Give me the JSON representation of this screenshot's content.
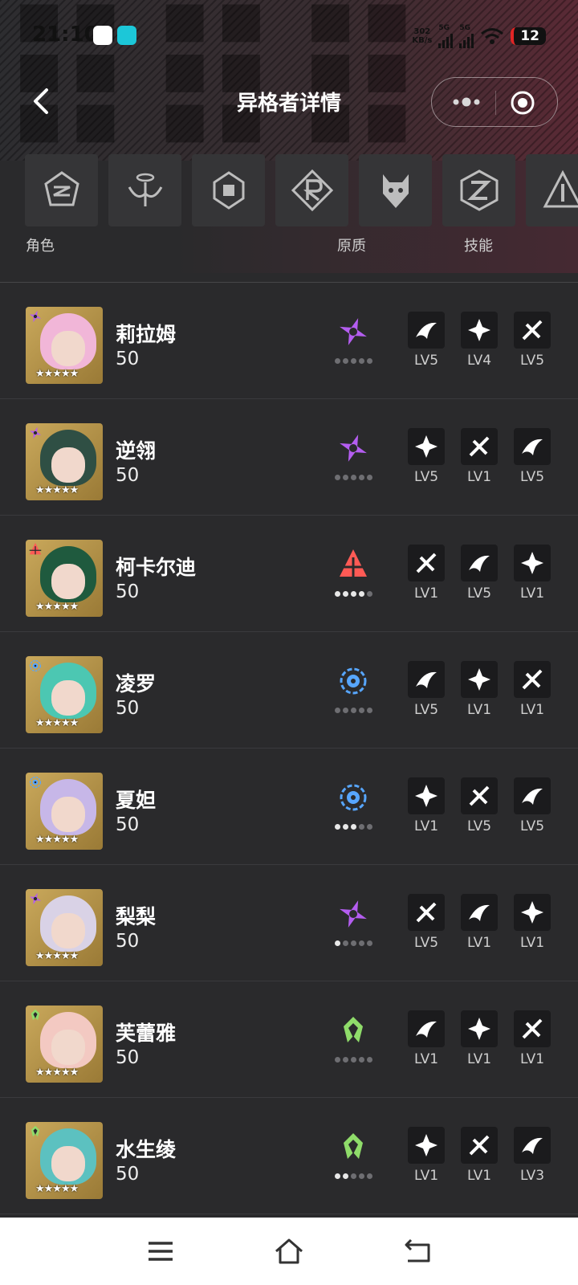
{
  "status_bar": {
    "time": "21:10",
    "net_speed_value": "302",
    "net_speed_unit": "KB/s",
    "network_a": "5G",
    "network_b": "5G",
    "battery": "12"
  },
  "header": {
    "title": "异格者详情"
  },
  "faction_icons": [
    "faction-emblem-1-icon",
    "faction-emblem-2-icon",
    "faction-emblem-3-icon",
    "faction-emblem-4-icon",
    "faction-emblem-5-icon",
    "faction-emblem-6-icon",
    "faction-emblem-7-icon"
  ],
  "columns": {
    "role": "角色",
    "quality": "原质",
    "skills": "技能"
  },
  "colors": {
    "purple": "#b45df0",
    "red": "#ff5a55",
    "blue": "#57a6ff",
    "green": "#8fdc6a"
  },
  "characters": [
    {
      "name": "莉拉姆",
      "level": "50",
      "element": "purple",
      "quality": 0,
      "skills": [
        "LV5",
        "LV4",
        "LV5"
      ],
      "hair": "#f1b6d8"
    },
    {
      "name": "逆翎",
      "level": "50",
      "element": "purple",
      "quality": 0,
      "skills": [
        "LV5",
        "LV1",
        "LV5"
      ],
      "hair": "#2f4f44"
    },
    {
      "name": "柯卡尔迪",
      "level": "50",
      "element": "red",
      "quality": 4,
      "skills": [
        "LV1",
        "LV5",
        "LV1"
      ],
      "hair": "#1f5a3e"
    },
    {
      "name": "凌罗",
      "level": "50",
      "element": "blue",
      "quality": 0,
      "skills": [
        "LV5",
        "LV1",
        "LV1"
      ],
      "hair": "#4cc7b2"
    },
    {
      "name": "夏妲",
      "level": "50",
      "element": "blue",
      "quality": 3,
      "skills": [
        "LV1",
        "LV5",
        "LV5"
      ],
      "hair": "#c7b7e8"
    },
    {
      "name": "梨梨",
      "level": "50",
      "element": "purple",
      "quality": 1,
      "skills": [
        "LV5",
        "LV1",
        "LV1"
      ],
      "hair": "#d9d2e6"
    },
    {
      "name": "芙蕾雅",
      "level": "50",
      "element": "green",
      "quality": 0,
      "skills": [
        "LV1",
        "LV1",
        "LV1"
      ],
      "hair": "#f3c9c2"
    },
    {
      "name": "水生绫",
      "level": "50",
      "element": "green",
      "quality": 2,
      "skills": [
        "LV1",
        "LV1",
        "LV3"
      ],
      "hair": "#5cc1c0"
    }
  ],
  "rarity_stars": "★★★★★",
  "nav": {
    "menu": "menu-icon",
    "home": "home-icon",
    "back": "back-icon"
  }
}
